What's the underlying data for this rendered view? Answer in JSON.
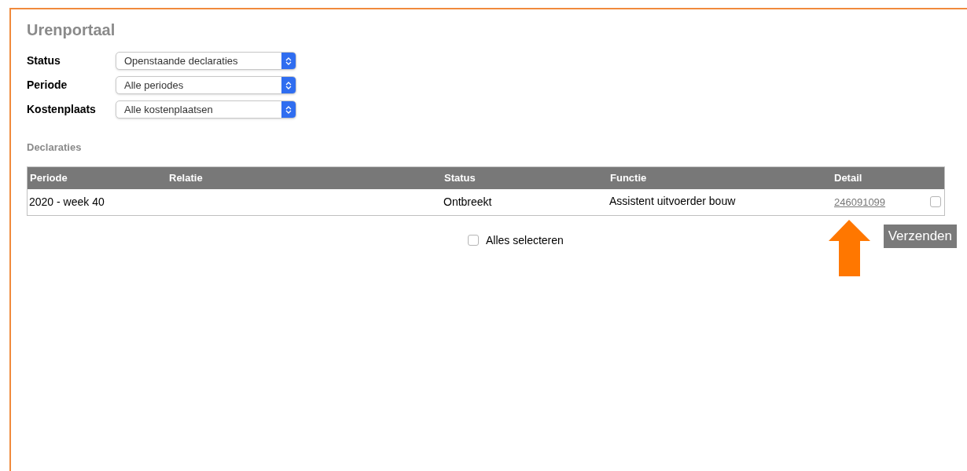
{
  "title": "Urenportaal",
  "filters": [
    {
      "label": "Status",
      "value": "Openstaande declaraties"
    },
    {
      "label": "Periode",
      "value": "Alle periodes"
    },
    {
      "label": "Kostenplaats",
      "value": "Alle kostenplaatsen"
    }
  ],
  "section_title": "Declaraties",
  "table": {
    "columns": [
      "Periode",
      "Relatie",
      "Status",
      "Functie",
      "Detail"
    ],
    "rows": [
      {
        "periode": "2020 - week 40",
        "relatie": "",
        "status": "Ontbreekt",
        "functie": "Assistent uitvoerder bouw",
        "detail": "246091099",
        "checked": false
      }
    ]
  },
  "select_all": {
    "label": "Alles selecteren",
    "checked": false
  },
  "submit_button": "Verzenden"
}
